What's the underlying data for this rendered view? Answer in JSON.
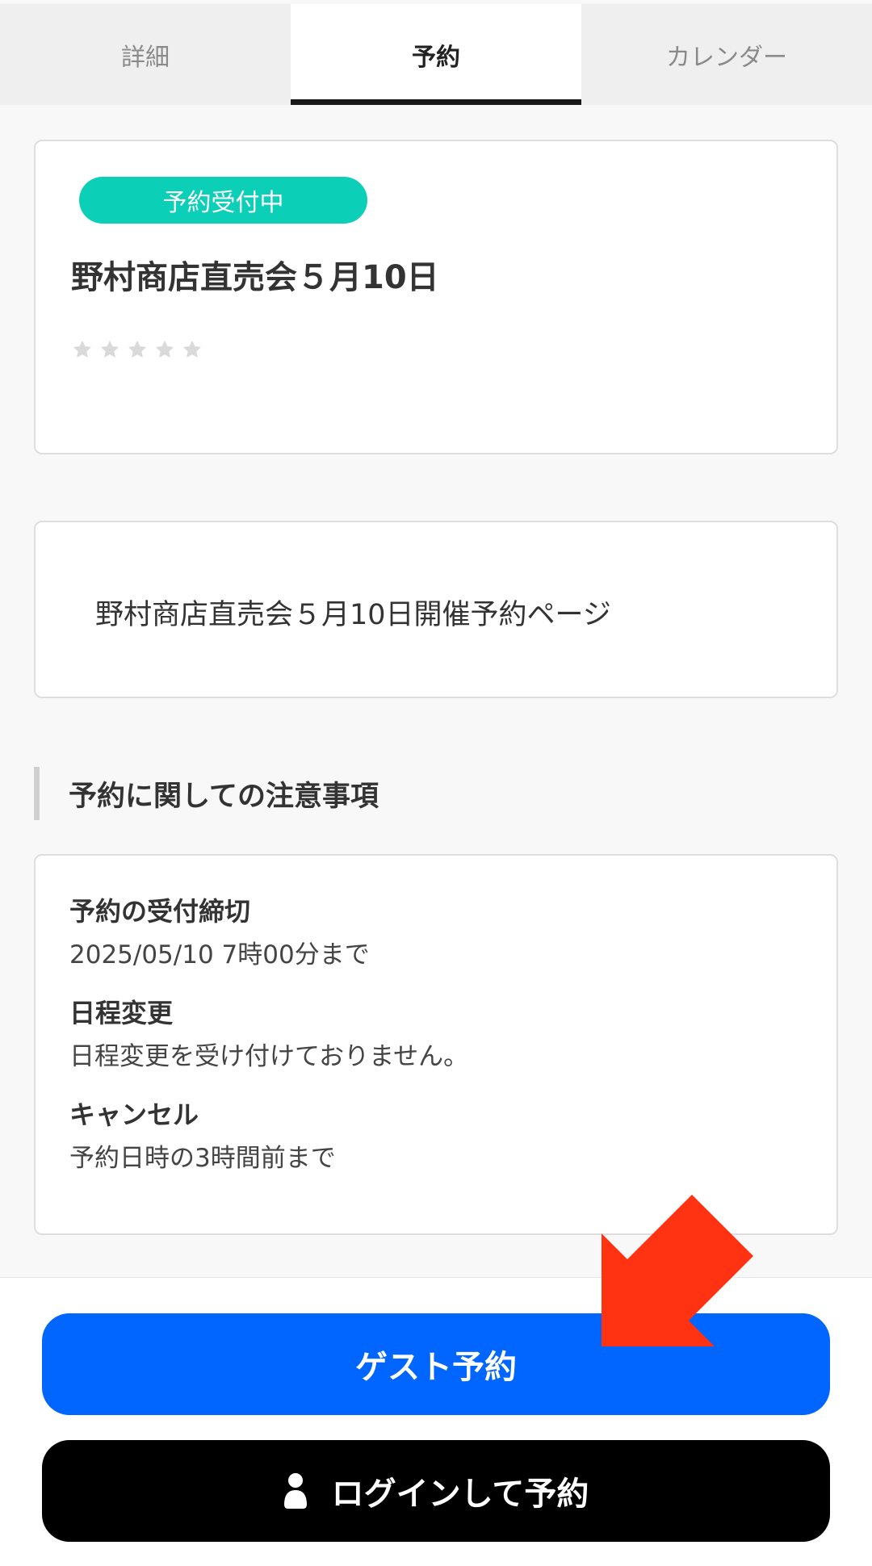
{
  "tabs": [
    {
      "label": "詳細",
      "active": false
    },
    {
      "label": "予約",
      "active": true
    },
    {
      "label": "カレンダー",
      "active": false
    }
  ],
  "event": {
    "status_badge": "予約受付中",
    "title": "野村商店直売会５月10日",
    "rating_stars": 0,
    "rating_max": 5,
    "description": "野村商店直売会５月10日開催予約ページ"
  },
  "notes": {
    "heading": "予約に関しての注意事項",
    "items": [
      {
        "title": "予約の受付締切",
        "body": "2025/05/10 7時00分まで"
      },
      {
        "title": "日程変更",
        "body": "日程変更を受け付けておりません。"
      },
      {
        "title": "キャンセル",
        "body": "予約日時の3時間前まで"
      }
    ]
  },
  "actions": {
    "guest_label": "ゲスト予約",
    "login_label": "ログインして予約"
  },
  "icons": {
    "star": "star-icon",
    "user": "user-icon",
    "annotation": "arrow-pointer-icon"
  },
  "colors": {
    "badge": "#0ccfb8",
    "guest_button": "#0066ff",
    "login_button": "#000000",
    "arrow": "#ff3311"
  }
}
